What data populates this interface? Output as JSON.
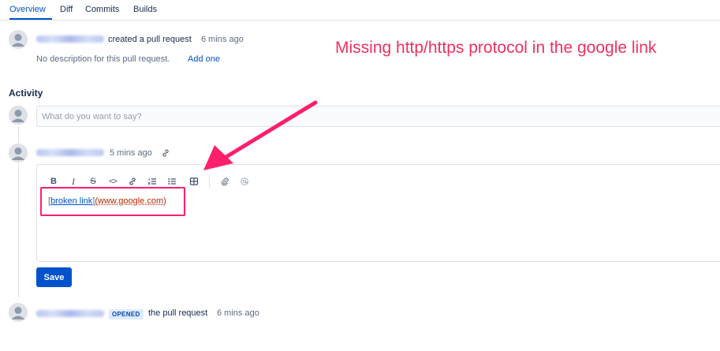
{
  "tabs": [
    {
      "label": "Overview",
      "active": true
    },
    {
      "label": "Diff",
      "active": false
    },
    {
      "label": "Commits",
      "active": false
    },
    {
      "label": "Builds",
      "active": false
    }
  ],
  "created_event": {
    "action": "created a pull request",
    "time": "6 mins ago",
    "description": "No description for this pull request.",
    "add_link": "Add one"
  },
  "activity": {
    "heading": "Activity",
    "comment_placeholder": "What do you want to say?"
  },
  "comment": {
    "time": "5 mins ago",
    "link_icon": "link-icon",
    "toolbar": [
      {
        "name": "bold",
        "glyph": "B"
      },
      {
        "name": "italic",
        "glyph": "I"
      },
      {
        "name": "strikethrough",
        "glyph": "S"
      },
      {
        "name": "code",
        "glyph": "<>"
      },
      {
        "name": "link",
        "glyph": "link"
      },
      {
        "name": "numbered-list",
        "glyph": "ol"
      },
      {
        "name": "bullet-list",
        "glyph": "ul"
      },
      {
        "name": "table",
        "glyph": "table"
      },
      {
        "name": "attachment",
        "glyph": "paperclip"
      },
      {
        "name": "mention",
        "glyph": "at"
      }
    ],
    "content": {
      "open_bracket": "[",
      "link_text": "broken link",
      "close_bracket": "]",
      "url_text": "(www.google.com)"
    },
    "save_label": "Save"
  },
  "opened_event": {
    "badge": "OPENED",
    "action": "the pull request",
    "time": "6 mins ago"
  },
  "annotation": {
    "text": "Missing http/https protocol in the google link",
    "color": "#f0305f"
  },
  "colors": {
    "accent": "#0052cc",
    "highlight": "#ff1f6b"
  }
}
